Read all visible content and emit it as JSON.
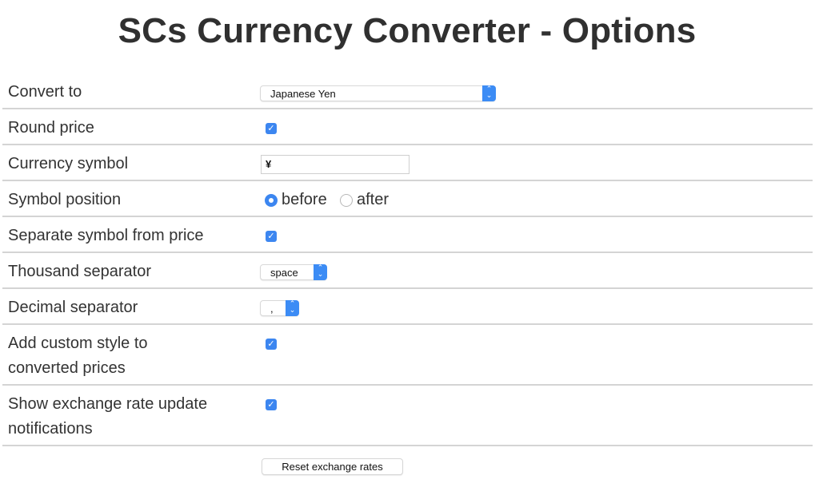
{
  "page": {
    "title": "SCs Currency Converter - Options"
  },
  "options": {
    "convert_to": {
      "label": "Convert to",
      "selected": "Japanese Yen"
    },
    "round_price": {
      "label": "Round price",
      "checked": true
    },
    "currency_symbol": {
      "label": "Currency symbol",
      "value": "¥"
    },
    "symbol_position": {
      "label": "Symbol position",
      "options": [
        "before",
        "after"
      ],
      "selected": "before"
    },
    "separate_symbol": {
      "label": "Separate symbol from price",
      "checked": true
    },
    "thousand_separator": {
      "label": "Thousand separator",
      "selected": "space"
    },
    "decimal_separator": {
      "label": "Decimal separator",
      "selected": ","
    },
    "custom_style": {
      "label_line1": "Add custom style to",
      "label_line2": "converted prices",
      "checked": true
    },
    "notifications": {
      "label_line1": "Show exchange rate update",
      "label_line2": "notifications",
      "checked": true
    }
  },
  "actions": {
    "reset_label": "Reset exchange rates"
  },
  "icons": {
    "check": "✓",
    "spin_up": "⌃",
    "spin_down": "⌄"
  },
  "colors": {
    "accent": "#3c86f0",
    "divider": "#d4d4d4",
    "text": "#333333"
  }
}
